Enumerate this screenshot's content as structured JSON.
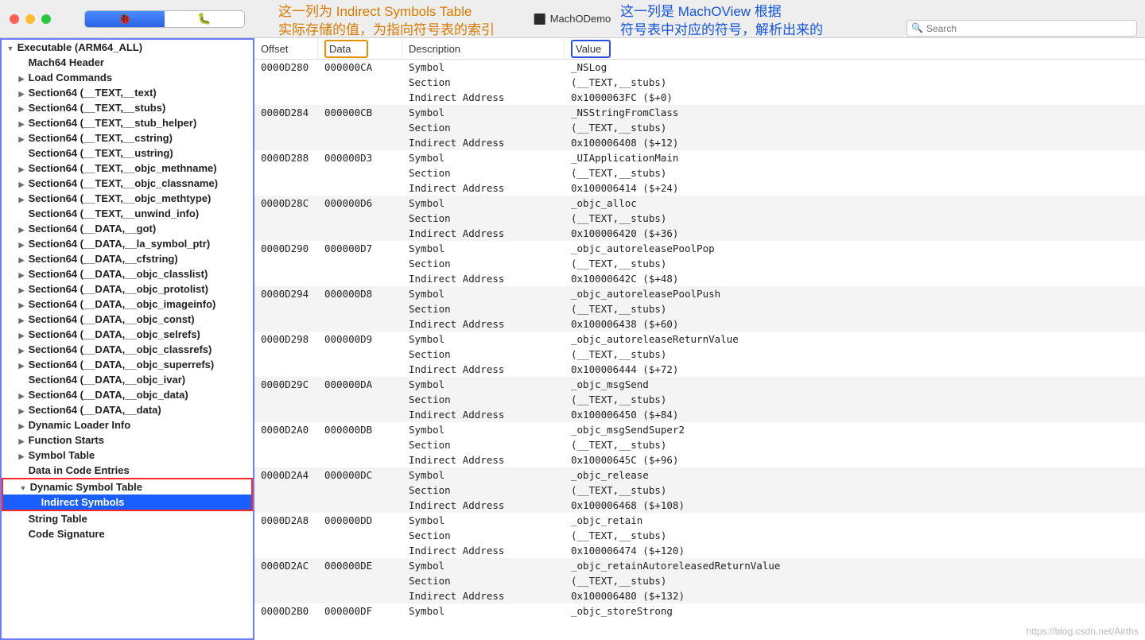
{
  "window": {
    "title": "MachODemo",
    "search_placeholder": "Search"
  },
  "annotations": {
    "orange_line1": "这一列为 Indirect Symbols Table",
    "orange_line2": "实际存储的值，为指向符号表的索引",
    "blue_line1": "这一列是 MachOView 根据",
    "blue_line2": "符号表中对应的符号，解析出来的"
  },
  "columns": {
    "offset": "Offset",
    "data": "Data",
    "description": "Description",
    "value": "Value"
  },
  "sidebar": [
    {
      "label": "Executable  (ARM64_ALL)",
      "indent": 0,
      "arrow": "▼",
      "bold": true
    },
    {
      "label": "Mach64 Header",
      "indent": 1,
      "arrow": "",
      "bold": true
    },
    {
      "label": "Load Commands",
      "indent": 1,
      "arrow": "▶",
      "bold": true
    },
    {
      "label": "Section64 (__TEXT,__text)",
      "indent": 1,
      "arrow": "▶",
      "bold": true
    },
    {
      "label": "Section64 (__TEXT,__stubs)",
      "indent": 1,
      "arrow": "▶",
      "bold": true
    },
    {
      "label": "Section64 (__TEXT,__stub_helper)",
      "indent": 1,
      "arrow": "▶",
      "bold": true
    },
    {
      "label": "Section64 (__TEXT,__cstring)",
      "indent": 1,
      "arrow": "▶",
      "bold": true
    },
    {
      "label": "Section64 (__TEXT,__ustring)",
      "indent": 1,
      "arrow": "",
      "bold": true
    },
    {
      "label": "Section64 (__TEXT,__objc_methname)",
      "indent": 1,
      "arrow": "▶",
      "bold": true
    },
    {
      "label": "Section64 (__TEXT,__objc_classname)",
      "indent": 1,
      "arrow": "▶",
      "bold": true
    },
    {
      "label": "Section64 (__TEXT,__objc_methtype)",
      "indent": 1,
      "arrow": "▶",
      "bold": true
    },
    {
      "label": "Section64 (__TEXT,__unwind_info)",
      "indent": 1,
      "arrow": "",
      "bold": true
    },
    {
      "label": "Section64 (__DATA,__got)",
      "indent": 1,
      "arrow": "▶",
      "bold": true
    },
    {
      "label": "Section64 (__DATA,__la_symbol_ptr)",
      "indent": 1,
      "arrow": "▶",
      "bold": true
    },
    {
      "label": "Section64 (__DATA,__cfstring)",
      "indent": 1,
      "arrow": "▶",
      "bold": true
    },
    {
      "label": "Section64 (__DATA,__objc_classlist)",
      "indent": 1,
      "arrow": "▶",
      "bold": true
    },
    {
      "label": "Section64 (__DATA,__objc_protolist)",
      "indent": 1,
      "arrow": "▶",
      "bold": true
    },
    {
      "label": "Section64 (__DATA,__objc_imageinfo)",
      "indent": 1,
      "arrow": "▶",
      "bold": true
    },
    {
      "label": "Section64 (__DATA,__objc_const)",
      "indent": 1,
      "arrow": "▶",
      "bold": true
    },
    {
      "label": "Section64 (__DATA,__objc_selrefs)",
      "indent": 1,
      "arrow": "▶",
      "bold": true
    },
    {
      "label": "Section64 (__DATA,__objc_classrefs)",
      "indent": 1,
      "arrow": "▶",
      "bold": true
    },
    {
      "label": "Section64 (__DATA,__objc_superrefs)",
      "indent": 1,
      "arrow": "▶",
      "bold": true
    },
    {
      "label": "Section64 (__DATA,__objc_ivar)",
      "indent": 1,
      "arrow": "",
      "bold": true
    },
    {
      "label": "Section64 (__DATA,__objc_data)",
      "indent": 1,
      "arrow": "▶",
      "bold": true
    },
    {
      "label": "Section64 (__DATA,__data)",
      "indent": 1,
      "arrow": "▶",
      "bold": true
    },
    {
      "label": "Dynamic Loader Info",
      "indent": 1,
      "arrow": "▶",
      "bold": true
    },
    {
      "label": "Function Starts",
      "indent": 1,
      "arrow": "▶",
      "bold": true
    },
    {
      "label": "Symbol Table",
      "indent": 1,
      "arrow": "▶",
      "bold": true
    },
    {
      "label": "Data in Code Entries",
      "indent": 1,
      "arrow": "",
      "bold": true
    },
    {
      "label": "Dynamic Symbol Table",
      "indent": 1,
      "arrow": "▼",
      "bold": true,
      "redbox_start": true
    },
    {
      "label": "Indirect Symbols",
      "indent": 2,
      "arrow": "",
      "bold": true,
      "selected": true,
      "redbox_end": true
    },
    {
      "label": "String Table",
      "indent": 1,
      "arrow": "",
      "bold": true
    },
    {
      "label": "Code Signature",
      "indent": 1,
      "arrow": "",
      "bold": true
    }
  ],
  "groups": [
    {
      "offset": "0000D280",
      "data": "000000CA",
      "rows": [
        {
          "desc": "Symbol",
          "value": "_NSLog"
        },
        {
          "desc": "Section",
          "value": "(__TEXT,__stubs)"
        },
        {
          "desc": "Indirect Address",
          "value": "0x1000063FC ($+0)"
        }
      ]
    },
    {
      "offset": "0000D284",
      "data": "000000CB",
      "rows": [
        {
          "desc": "Symbol",
          "value": "_NSStringFromClass"
        },
        {
          "desc": "Section",
          "value": "(__TEXT,__stubs)"
        },
        {
          "desc": "Indirect Address",
          "value": "0x100006408 ($+12)"
        }
      ]
    },
    {
      "offset": "0000D288",
      "data": "000000D3",
      "rows": [
        {
          "desc": "Symbol",
          "value": "_UIApplicationMain"
        },
        {
          "desc": "Section",
          "value": "(__TEXT,__stubs)"
        },
        {
          "desc": "Indirect Address",
          "value": "0x100006414 ($+24)"
        }
      ]
    },
    {
      "offset": "0000D28C",
      "data": "000000D6",
      "rows": [
        {
          "desc": "Symbol",
          "value": "_objc_alloc"
        },
        {
          "desc": "Section",
          "value": "(__TEXT,__stubs)"
        },
        {
          "desc": "Indirect Address",
          "value": "0x100006420 ($+36)"
        }
      ]
    },
    {
      "offset": "0000D290",
      "data": "000000D7",
      "rows": [
        {
          "desc": "Symbol",
          "value": "_objc_autoreleasePoolPop"
        },
        {
          "desc": "Section",
          "value": "(__TEXT,__stubs)"
        },
        {
          "desc": "Indirect Address",
          "value": "0x10000642C ($+48)"
        }
      ]
    },
    {
      "offset": "0000D294",
      "data": "000000D8",
      "rows": [
        {
          "desc": "Symbol",
          "value": "_objc_autoreleasePoolPush"
        },
        {
          "desc": "Section",
          "value": "(__TEXT,__stubs)"
        },
        {
          "desc": "Indirect Address",
          "value": "0x100006438 ($+60)"
        }
      ]
    },
    {
      "offset": "0000D298",
      "data": "000000D9",
      "rows": [
        {
          "desc": "Symbol",
          "value": "_objc_autoreleaseReturnValue"
        },
        {
          "desc": "Section",
          "value": "(__TEXT,__stubs)"
        },
        {
          "desc": "Indirect Address",
          "value": "0x100006444 ($+72)"
        }
      ]
    },
    {
      "offset": "0000D29C",
      "data": "000000DA",
      "rows": [
        {
          "desc": "Symbol",
          "value": "_objc_msgSend"
        },
        {
          "desc": "Section",
          "value": "(__TEXT,__stubs)"
        },
        {
          "desc": "Indirect Address",
          "value": "0x100006450 ($+84)"
        }
      ]
    },
    {
      "offset": "0000D2A0",
      "data": "000000DB",
      "rows": [
        {
          "desc": "Symbol",
          "value": "_objc_msgSendSuper2"
        },
        {
          "desc": "Section",
          "value": "(__TEXT,__stubs)"
        },
        {
          "desc": "Indirect Address",
          "value": "0x10000645C ($+96)"
        }
      ]
    },
    {
      "offset": "0000D2A4",
      "data": "000000DC",
      "rows": [
        {
          "desc": "Symbol",
          "value": "_objc_release"
        },
        {
          "desc": "Section",
          "value": "(__TEXT,__stubs)"
        },
        {
          "desc": "Indirect Address",
          "value": "0x100006468 ($+108)"
        }
      ]
    },
    {
      "offset": "0000D2A8",
      "data": "000000DD",
      "rows": [
        {
          "desc": "Symbol",
          "value": "_objc_retain"
        },
        {
          "desc": "Section",
          "value": "(__TEXT,__stubs)"
        },
        {
          "desc": "Indirect Address",
          "value": "0x100006474 ($+120)"
        }
      ]
    },
    {
      "offset": "0000D2AC",
      "data": "000000DE",
      "rows": [
        {
          "desc": "Symbol",
          "value": "_objc_retainAutoreleasedReturnValue"
        },
        {
          "desc": "Section",
          "value": "(__TEXT,__stubs)"
        },
        {
          "desc": "Indirect Address",
          "value": "0x100006480 ($+132)"
        }
      ]
    },
    {
      "offset": "0000D2B0",
      "data": "000000DF",
      "rows": [
        {
          "desc": "Symbol",
          "value": "_objc_storeStrong"
        }
      ]
    }
  ],
  "watermark": "https://blog.csdn.net/Airths"
}
